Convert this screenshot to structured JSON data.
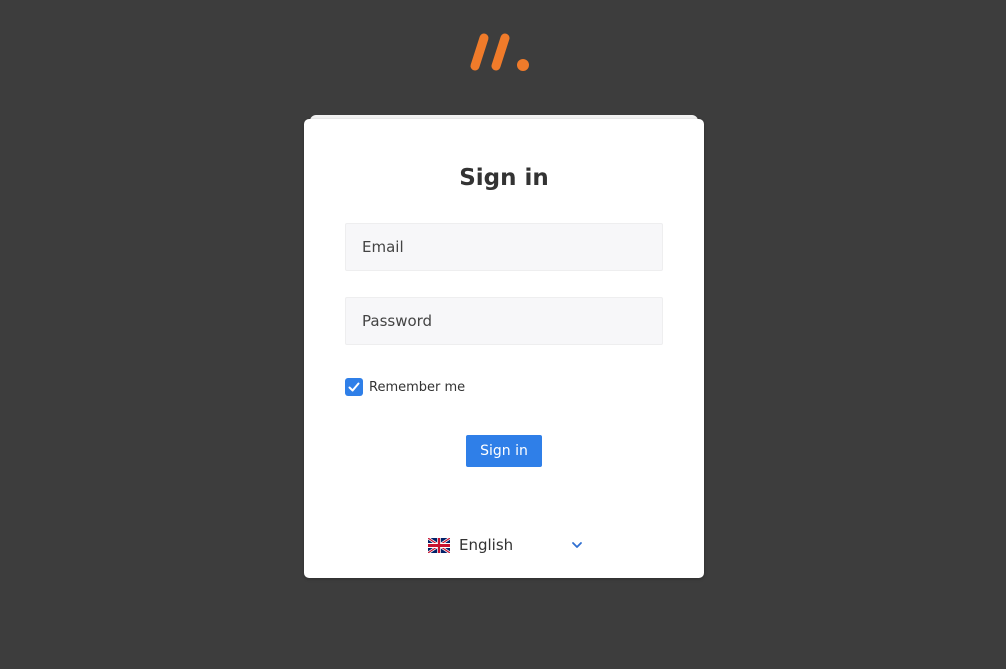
{
  "brand": {
    "logo_icon": "app-logo-icon",
    "accent_color": "#f07b2a"
  },
  "form": {
    "title": "Sign in",
    "email_placeholder": "Email",
    "password_placeholder": "Password",
    "remember_label": "Remember me",
    "remember_checked": true,
    "submit_label": "Sign in",
    "primary_color": "#2f7fe8"
  },
  "language": {
    "selected": "English",
    "flag_icon": "uk-flag-icon",
    "dropdown_icon": "chevron-down-icon"
  }
}
